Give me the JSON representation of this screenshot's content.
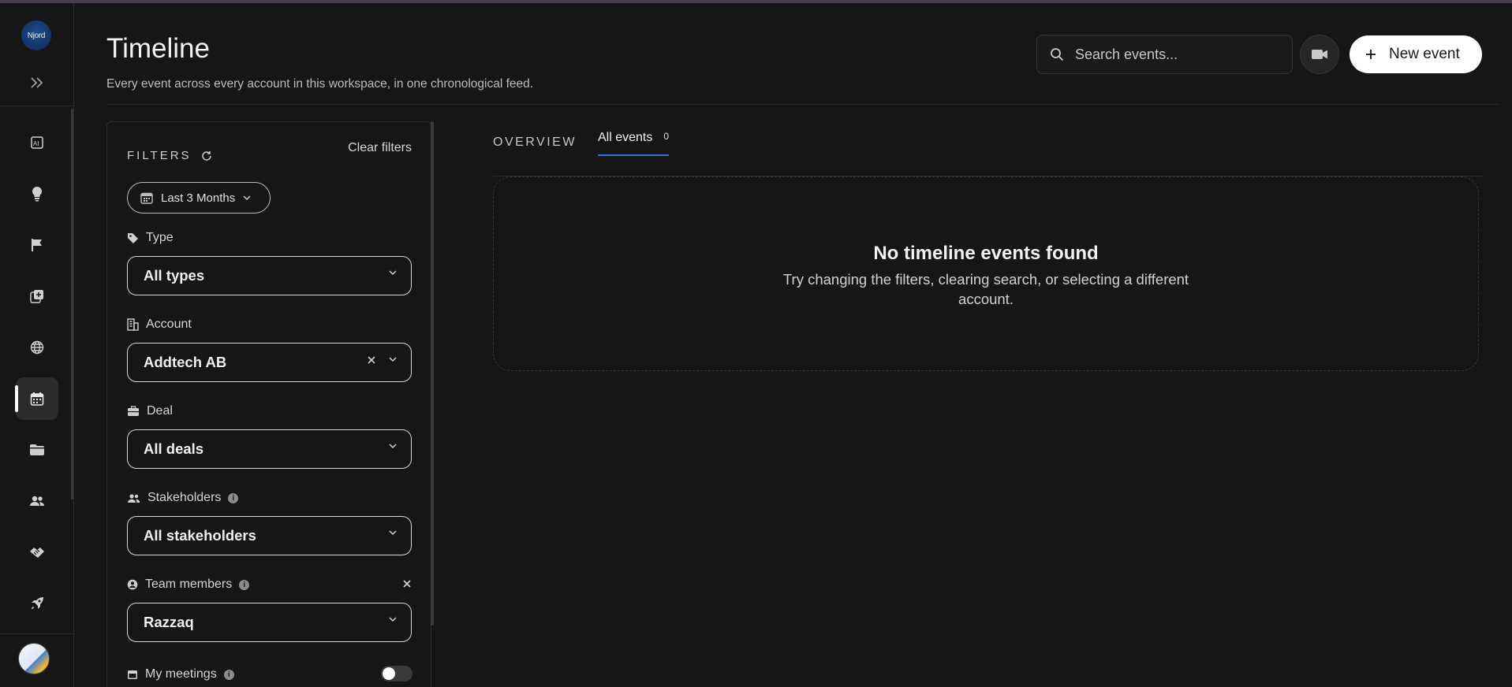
{
  "app": {
    "logo_text": "Njord"
  },
  "header": {
    "title": "Timeline",
    "subtitle": "Every event across every account in this workspace, in one chronological feed.",
    "search_placeholder": "Search events...",
    "new_event_label": "New event"
  },
  "sidebar": {
    "items": [
      {
        "icon": "ai-report-icon",
        "active": false
      },
      {
        "icon": "lightbulb-icon",
        "active": false
      },
      {
        "icon": "flag-icon",
        "active": false
      },
      {
        "icon": "add-copy-icon",
        "active": false
      },
      {
        "icon": "globe-icon",
        "active": false
      },
      {
        "icon": "calendar-icon",
        "active": true
      },
      {
        "icon": "folder-icon",
        "active": false
      },
      {
        "icon": "people-icon",
        "active": false
      },
      {
        "icon": "handshake-icon",
        "active": false
      },
      {
        "icon": "rocket-icon",
        "active": false
      }
    ]
  },
  "filters": {
    "heading": "FILTERS",
    "clear_label": "Clear filters",
    "date_range": "Last 3 Months",
    "type": {
      "label": "Type",
      "value": "All types"
    },
    "account": {
      "label": "Account",
      "value": "Addtech AB"
    },
    "deal": {
      "label": "Deal",
      "value": "All deals"
    },
    "stakeholders": {
      "label": "Stakeholders",
      "value": "All stakeholders"
    },
    "team_members": {
      "label": "Team members",
      "value": "Razzaq"
    },
    "my_meetings": {
      "label": "My meetings",
      "enabled": false
    }
  },
  "tabs": {
    "overview": "OVERVIEW",
    "all_events": "All events",
    "all_events_count": "0"
  },
  "empty_state": {
    "title": "No timeline events found",
    "message": "Try changing the filters, clearing search, or selecting a different account."
  },
  "colors": {
    "background": "#161616",
    "accent_underline": "#3b6fd6",
    "primary_button": "#ffffff"
  }
}
